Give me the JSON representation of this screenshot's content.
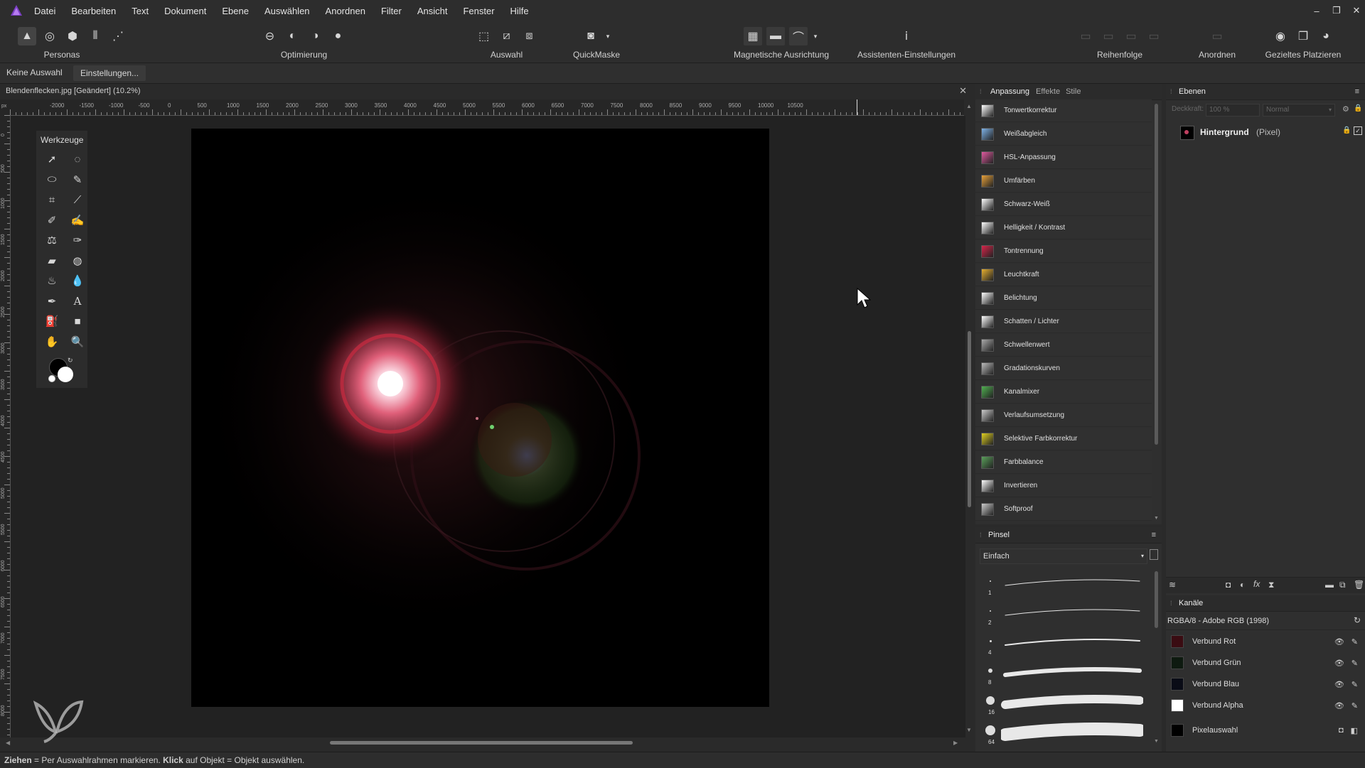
{
  "menubar": {
    "items": [
      "Datei",
      "Bearbeiten",
      "Text",
      "Dokument",
      "Ebene",
      "Auswählen",
      "Anordnen",
      "Filter",
      "Ansicht",
      "Fenster",
      "Hilfe"
    ],
    "window_controls": [
      "–",
      "❐",
      "✕"
    ]
  },
  "toolbar": {
    "personas_label": "Personas",
    "optimierung_label": "Optimierung",
    "auswahl_label": "Auswahl",
    "quickmaske_label": "QuickMaske",
    "magnetische_label": "Magnetische Ausrichtung",
    "assistenten_label": "Assistenten-Einstellungen",
    "reihenfolge_label": "Reihenfolge",
    "anordnen_label": "Anordnen",
    "gezieltes_label": "Gezieltes Platzieren"
  },
  "context": {
    "selection_status": "Keine Auswahl",
    "settings_button": "Einstellungen..."
  },
  "document": {
    "tab_title": "Blendenflecken.jpg [Geändert] (10.2%)"
  },
  "rulers": {
    "h_ticks": [
      "-2000",
      "-1500",
      "-1000",
      "-500",
      "0",
      "500",
      "1000",
      "1500",
      "2000",
      "2500",
      "3000",
      "3500",
      "4000",
      "4500",
      "5000",
      "5500",
      "6000",
      "6500",
      "7000",
      "7500",
      "8000",
      "8500",
      "9000",
      "9500",
      "10000",
      "10500"
    ],
    "v_ticks": [
      "0",
      "500",
      "1000",
      "1500",
      "2000",
      "2500",
      "3000",
      "3500",
      "4000",
      "4500",
      "5000",
      "5500",
      "6000",
      "6500",
      "7000",
      "7500",
      "8000"
    ]
  },
  "tools_panel": {
    "title": "Werkzeuge",
    "tools": [
      "move-tool",
      "selection-brush-tool",
      "freehand-selection-tool",
      "paint-brush-tool",
      "crop-tool",
      "color-picker-tool",
      "flood-select-tool",
      "smudge-tool",
      "clone-tool",
      "healing-brush-tool",
      "erase-tool",
      "dodge-tool",
      "blur-tool",
      "sharpen-tool",
      "pen-tool",
      "text-tool",
      "fill-tool",
      "rectangle-tool",
      "hand-tool",
      "zoom-tool"
    ]
  },
  "adjustments_panel": {
    "tabs": [
      "Anpassung",
      "Effekte",
      "Stile"
    ],
    "items": [
      {
        "name": "Tonwertkorrektur",
        "icon": "levels-icon",
        "color": "#ffffff"
      },
      {
        "name": "Weißabgleich",
        "icon": "white-balance-icon",
        "color": "#7fb3e8"
      },
      {
        "name": "HSL-Anpassung",
        "icon": "hsl-icon",
        "color": "#e05aa0"
      },
      {
        "name": "Umfärben",
        "icon": "recolor-icon",
        "color": "#e8a13a"
      },
      {
        "name": "Schwarz-Weiß",
        "icon": "black-white-icon",
        "color": "#ffffff"
      },
      {
        "name": "Helligkeit / Kontrast",
        "icon": "brightness-contrast-icon",
        "color": "#ffffff"
      },
      {
        "name": "Tontrennung",
        "icon": "posterize-icon",
        "color": "#d9254a"
      },
      {
        "name": "Leuchtkraft",
        "icon": "vibrance-icon",
        "color": "#e8b030"
      },
      {
        "name": "Belichtung",
        "icon": "exposure-icon",
        "color": "#ffffff"
      },
      {
        "name": "Schatten / Lichter",
        "icon": "shadows-highlights-icon",
        "color": "#ffffff"
      },
      {
        "name": "Schwellenwert",
        "icon": "threshold-icon",
        "color": "#aaaaaa"
      },
      {
        "name": "Gradationskurven",
        "icon": "curves-icon",
        "color": "#bbbbbb"
      },
      {
        "name": "Kanalmixer",
        "icon": "channel-mixer-icon",
        "color": "#50b050"
      },
      {
        "name": "Verlaufsumsetzung",
        "icon": "gradient-map-icon",
        "color": "#cccccc"
      },
      {
        "name": "Selektive Farbkorrektur",
        "icon": "selective-color-icon",
        "color": "#e0d020"
      },
      {
        "name": "Farbbalance",
        "icon": "color-balance-icon",
        "color": "#5aa05a"
      },
      {
        "name": "Invertieren",
        "icon": "invert-icon",
        "color": "#ffffff"
      },
      {
        "name": "Softproof",
        "icon": "soft-proof-icon",
        "color": "#cccccc"
      }
    ]
  },
  "brush_panel": {
    "title": "Pinsel",
    "category": "Einfach",
    "sizes": [
      "1",
      "2",
      "4",
      "8",
      "16",
      "64"
    ]
  },
  "layers_panel": {
    "title": "Ebenen",
    "opacity_label": "Deckkraft:",
    "opacity": "100 %",
    "blend_mode": "Normal",
    "layer_name": "Hintergrund",
    "layer_type": "(Pixel)"
  },
  "channels_panel": {
    "title": "Kanäle",
    "profile": "RGBA/8 - Adobe RGB (1998)",
    "channels": [
      {
        "name": "Verbund Rot",
        "color": "#3a0c12"
      },
      {
        "name": "Verbund Grün",
        "color": "#0e1a10"
      },
      {
        "name": "Verbund Blau",
        "color": "#0a0c16"
      },
      {
        "name": "Verbund Alpha",
        "color": "#ffffff"
      }
    ],
    "pixel_selection": "Pixelauswahl"
  },
  "status": {
    "key1": "Ziehen",
    "text1": " = Per Auswahlrahmen markieren. ",
    "key2": "Klick",
    "text2": " auf Objekt = Objekt auswählen."
  }
}
